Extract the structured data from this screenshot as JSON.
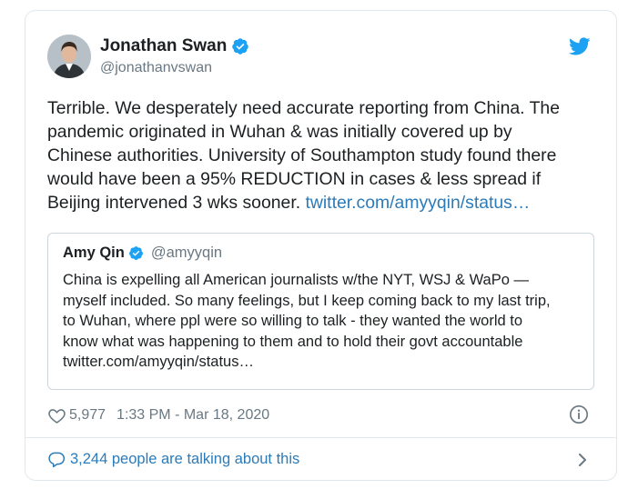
{
  "author": {
    "name": "Jonathan Swan",
    "handle": "@jonathanvswan"
  },
  "tweet": {
    "text": "Terrible. We desperately need accurate reporting from China. The\npandemic originated in Wuhan & was initially covered up by\nChinese authorities. University of Southampton study found there\nwould have been a 95% REDUCTION in cases & less spread if\nBeijing intervened 3 wks sooner. ",
    "link": "twitter.com/amyyqin/status…"
  },
  "quoted": {
    "name": "Amy Qin",
    "handle": "@amyyqin",
    "text": "China is expelling all American journalists w/the NYT, WSJ & WaPo —\nmyself included. So many feelings, but I keep coming back to my last trip,\nto Wuhan, where ppl were so willing to talk - they wanted the world to\nknow what was happening to them and to hold their govt accountable\ntwitter.com/amyyqin/status…"
  },
  "meta": {
    "likes": "5,977",
    "timestamp": "1:33 PM - Mar 18, 2020"
  },
  "footer": {
    "talking": "3,244 people are talking about this"
  },
  "colors": {
    "accent": "#1da1f2",
    "link": "#2b7bb9",
    "muted": "#697882",
    "border": "#e1e8ed"
  },
  "icons": [
    "verified-badge-icon",
    "twitter-bird-icon",
    "heart-icon",
    "info-icon",
    "comment-bubble-icon",
    "chevron-right-icon"
  ]
}
